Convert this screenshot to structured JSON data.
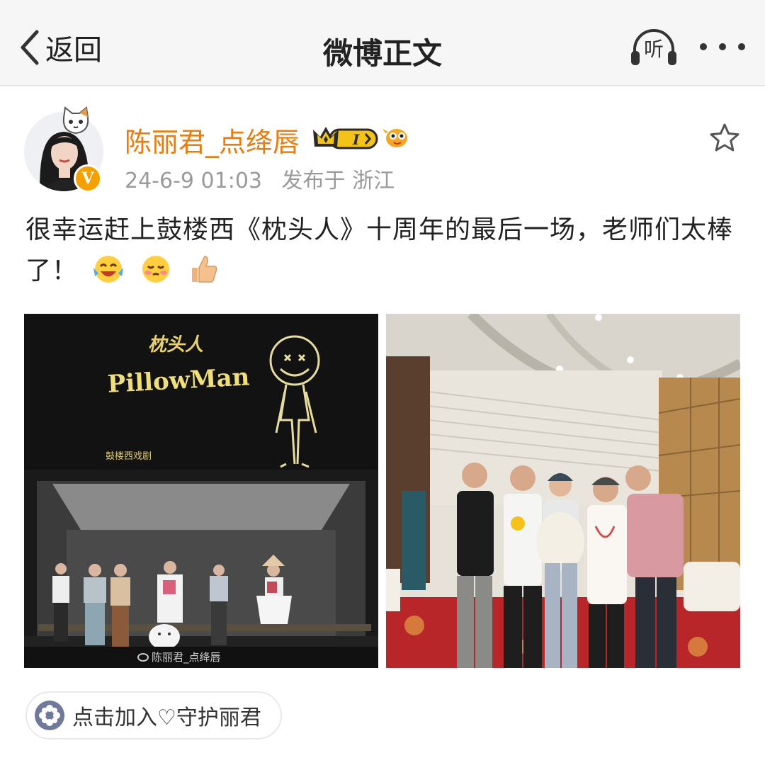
{
  "header": {
    "back_label": "返回",
    "title": "微博正文",
    "listen_label": "听",
    "back_icon": "chevron-left-icon",
    "listen_icon": "headphones-icon",
    "more_icon": "more-dots-icon"
  },
  "post": {
    "author": {
      "name": "陈丽君_点绛唇",
      "verified_mark": "V",
      "member_level": "I",
      "accent_color": "#eb7b0d"
    },
    "timestamp": "24-6-9 01:03",
    "location_label": "发布于 浙江",
    "text": "很幸运赶上鼓楼西《枕头人》十周年的最后一场，老师们太棒了！",
    "emojis": [
      "laugh-cry-emoji",
      "blush-emoji",
      "thumbs-up-emoji"
    ]
  },
  "images": {
    "stage": {
      "title_cn": "枕头人",
      "title_en": "PillowMan",
      "credit": "鼓楼西戏剧",
      "watermark": "陈丽君_点绛唇"
    }
  },
  "fan_group": {
    "label": "点击加入♡守护丽君",
    "icon": "fan-flower-icon"
  }
}
